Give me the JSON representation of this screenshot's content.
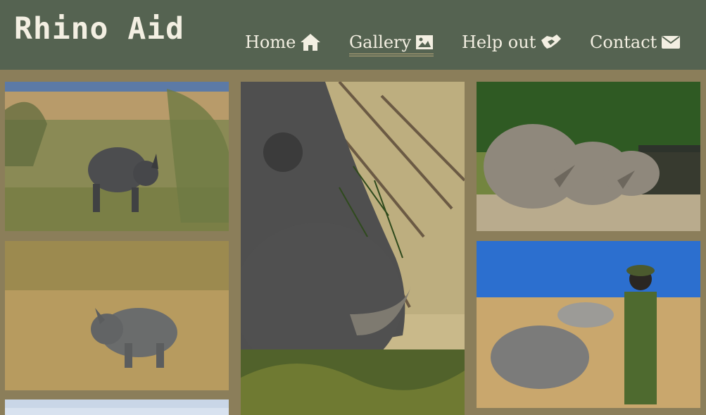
{
  "site": {
    "title": "Rhino Aid"
  },
  "nav": [
    {
      "label": "Home",
      "icon": "home-icon",
      "active": false
    },
    {
      "label": "Gallery",
      "icon": "image-icon",
      "active": true
    },
    {
      "label": "Help out",
      "icon": "handshake-icon",
      "active": false
    },
    {
      "label": "Contact",
      "icon": "envelope-icon",
      "active": false
    }
  ],
  "gallery": {
    "images": [
      {
        "description": "black rhino walking in savanna"
      },
      {
        "description": "close-up of grazing rhino with horn"
      },
      {
        "description": "group of white rhinos by fence"
      },
      {
        "description": "baby rhino walking on dry ground"
      },
      {
        "description": "ranger guarding rhinos"
      },
      {
        "description": "landscape partially visible"
      }
    ]
  },
  "colors": {
    "header": "#556351",
    "page_background": "#8b7e5a",
    "nav_text": "#f3efe2",
    "active_underline": "#b7a77b"
  }
}
